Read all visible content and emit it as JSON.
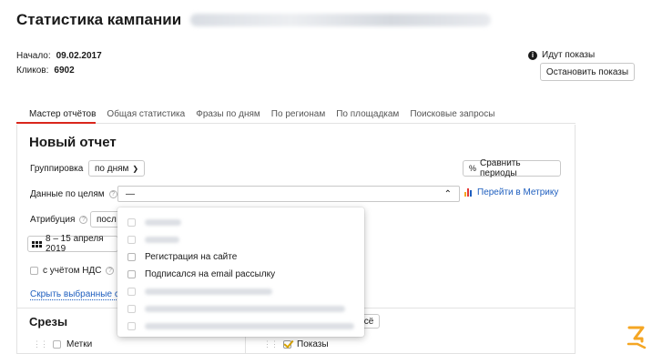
{
  "header": {
    "title": "Статистика кампании"
  },
  "meta": {
    "start_label": "Начало:",
    "start_value": "09.02.2017",
    "clicks_label": "Кликов:",
    "clicks_value": "6902"
  },
  "status": {
    "text": "Идут показы",
    "stop_button": "Остановить показы"
  },
  "tabs": [
    {
      "label": "Мастер отчётов",
      "active": true
    },
    {
      "label": "Общая статистика"
    },
    {
      "label": "Фразы по дням"
    },
    {
      "label": "По регионам"
    },
    {
      "label": "По площадкам"
    },
    {
      "label": "Поисковые запросы"
    }
  ],
  "report": {
    "title": "Новый отчет",
    "grouping_label": "Группировка",
    "grouping_value": "по дням",
    "compare_button": "Сравнить периоды",
    "goals_label": "Данные по целям",
    "goals_value": "—",
    "metrika_link": "Перейти в Метрику",
    "attribution_label": "Атрибуция",
    "attribution_value": "посл",
    "date_range": "8 – 15 апреля 2019",
    "vat_label": "с учётом НДС",
    "reset_link": "Скрыть выбранные ср"
  },
  "slices": {
    "title": "Срезы",
    "all_button": "сё",
    "left_item": "Метки",
    "right_item": "Показы"
  },
  "goals_dropdown": {
    "items": [
      {
        "label": "",
        "blurred": true
      },
      {
        "label": "",
        "blurred": true
      },
      {
        "label": "Регистрация на сайте",
        "blurred": false
      },
      {
        "label": "Подписался на email рассылку",
        "blurred": false
      },
      {
        "label": "",
        "blurred": true
      },
      {
        "label": "",
        "blurred": true
      },
      {
        "label": "",
        "blurred": true
      }
    ]
  },
  "colors": {
    "accent_red": "#d9261c",
    "link_blue": "#1f5fbf",
    "check_yellow": "#d8a400",
    "logo_orange": "#f5a623"
  }
}
